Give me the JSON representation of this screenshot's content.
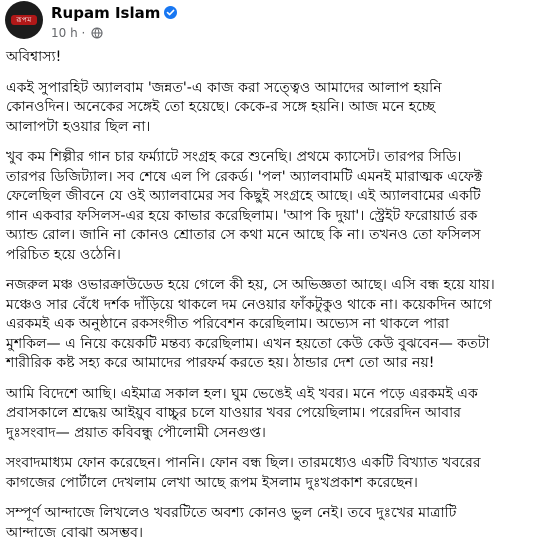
{
  "header": {
    "author_name": "Rupam Islam",
    "timestamp": "10 h",
    "separator": "·",
    "avatar_label": "রূপম"
  },
  "post": {
    "paragraphs": [
      "অবিশ্বাস্য!",
      "একই সুপারহিট অ্যালবাম 'জন্নত'-এ কাজ করা সত্ত্বেও আমাদের আলাপ হয়নি\nকোনওদিন। অনেকের সঙ্গেই তো হয়েছে। কেকে-র সঙ্গে হয়নি। আজ মনে হচ্ছে\nআলাপটা হওয়ার ছিল না।",
      "খুব কম শিল্পীর গান চার ফর্ম্যাটে সংগ্রহ করে শুনেছি। প্রথমে ক্যাসেট। তারপর সিডি।\nতারপর ডিজিট্যাল। সব শেষে এল পি রেকর্ড। 'পল' অ্যালবামটি এমনই মারাত্মক এফেক্ট\nফেলেছিল জীবনে যে ওই অ্যালবামের সব কিছুই সংগ্রহে আছে। এই অ্যালবামের একটি\nগান একবার ফসিলস-এর হয়ে কাভার করেছিলাম। 'আপ কি দুয়া'। স্ট্রেইট ফরোয়ার্ড রক\nঅ্যান্ড রোল। জানি না কোনও শ্রোতার সে কথা মনে আছে কি না। তখনও তো ফসিলস\nপরিচিত হয়ে ওঠেনি।",
      "নজরুল মঞ্চ ওভারক্রাউডেড হয়ে গেলে কী হয়, সে অভিজ্ঞতা আছে। এসি বন্ধ হয়ে যায়।\nমঞ্চেও সার বেঁধে দর্শক দাঁড়িয়ে থাকলে দম নেওয়ার ফাঁকটুকুও থাকে না। কয়েকদিন আগে\nএরকমই এক অনুষ্ঠানে রকসংগীত পরিবেশন করেছিলাম। অভ্যেস না থাকলে পারা\nমুশকিল— এ নিয়ে কয়েকটি মন্তব্য করেছিলাম। এখন হয়তো কেউ কেউ বুঝবেন— কতটা\nশারীরিক কষ্ট সহ্য করে আমাদের পারফর্ম করতে হয়। ঠান্ডার দেশ তো আর নয়!",
      "আমি বিদেশে আছি। এইমাত্র সকাল হল। ঘুম ভেঙেই এই খবর। মনে পড়ে এরকমই এক\nপ্রবাসকালে শ্রদ্ধেয় আইয়ুব বাচ্চুর চলে যাওয়ার খবর পেয়েছিলাম। পরেরদিন আবার\nদুঃসংবাদ— প্রয়াত কবিবন্ধু পৌলোমী সেনগুপ্ত।",
      "সংবাদমাধ্যম ফোন করেছেন। পাননি। ফোন বন্ধ ছিল। তারমধ্যেও একটি বিখ্যাত খবরের\nকাগজের পোর্টালে দেখলাম লেখা আছে রূপম ইসলাম দুঃখপ্রকাশ করেছেন।",
      "সম্পূর্ণ আন্দাজে লিখলেও খবরটিতে অবশ্য কোনও ভুল নেই। তবে দুঃখের মাত্রাটি\nআন্দাজে বোঝা অসম্ভব।"
    ]
  }
}
